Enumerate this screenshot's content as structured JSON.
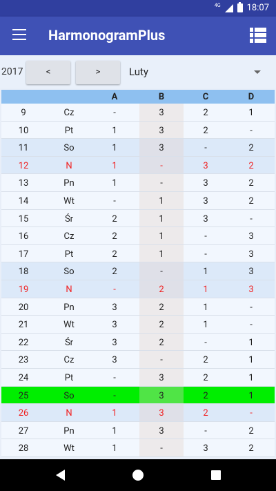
{
  "statusbar": {
    "network": "4G",
    "time": "18:07"
  },
  "appbar": {
    "title": "HarmonogramPlus"
  },
  "controls": {
    "year": "2017",
    "prev_label": "<",
    "next_label": ">",
    "month": "Luty"
  },
  "table": {
    "columns": [
      "A",
      "B",
      "C",
      "D"
    ],
    "rows": [
      {
        "day": "9",
        "dow": "Cz",
        "a": "-",
        "b": "3",
        "c": "2",
        "d": "1",
        "style": ""
      },
      {
        "day": "10",
        "dow": "Pt",
        "a": "1",
        "b": "3",
        "c": "2",
        "d": "-",
        "style": ""
      },
      {
        "day": "11",
        "dow": "So",
        "a": "1",
        "b": "3",
        "c": "-",
        "d": "2",
        "style": "weekend"
      },
      {
        "day": "12",
        "dow": "N",
        "a": "1",
        "b": "-",
        "c": "3",
        "d": "2",
        "style": "weekend holiday"
      },
      {
        "day": "13",
        "dow": "Pn",
        "a": "1",
        "b": "-",
        "c": "3",
        "d": "2",
        "style": ""
      },
      {
        "day": "14",
        "dow": "Wt",
        "a": "-",
        "b": "1",
        "c": "3",
        "d": "2",
        "style": ""
      },
      {
        "day": "15",
        "dow": "Śr",
        "a": "2",
        "b": "1",
        "c": "3",
        "d": "-",
        "style": ""
      },
      {
        "day": "16",
        "dow": "Cz",
        "a": "2",
        "b": "1",
        "c": "-",
        "d": "3",
        "style": ""
      },
      {
        "day": "17",
        "dow": "Pt",
        "a": "2",
        "b": "1",
        "c": "-",
        "d": "3",
        "style": ""
      },
      {
        "day": "18",
        "dow": "So",
        "a": "2",
        "b": "-",
        "c": "1",
        "d": "3",
        "style": "weekend"
      },
      {
        "day": "19",
        "dow": "N",
        "a": "-",
        "b": "2",
        "c": "1",
        "d": "3",
        "style": "weekend holiday"
      },
      {
        "day": "20",
        "dow": "Pn",
        "a": "3",
        "b": "2",
        "c": "1",
        "d": "-",
        "style": ""
      },
      {
        "day": "21",
        "dow": "Wt",
        "a": "3",
        "b": "2",
        "c": "1",
        "d": "-",
        "style": ""
      },
      {
        "day": "22",
        "dow": "Śr",
        "a": "3",
        "b": "2",
        "c": "-",
        "d": "1",
        "style": ""
      },
      {
        "day": "23",
        "dow": "Cz",
        "a": "3",
        "b": "-",
        "c": "2",
        "d": "1",
        "style": ""
      },
      {
        "day": "24",
        "dow": "Pt",
        "a": "-",
        "b": "3",
        "c": "2",
        "d": "1",
        "style": ""
      },
      {
        "day": "25",
        "dow": "So",
        "a": "-",
        "b": "3",
        "c": "2",
        "d": "1",
        "style": "today"
      },
      {
        "day": "26",
        "dow": "N",
        "a": "1",
        "b": "3",
        "c": "2",
        "d": "-",
        "style": "weekend holiday"
      },
      {
        "day": "27",
        "dow": "Pn",
        "a": "1",
        "b": "3",
        "c": "-",
        "d": "2",
        "style": ""
      },
      {
        "day": "28",
        "dow": "Wt",
        "a": "1",
        "b": "-",
        "c": "3",
        "d": "2",
        "style": ""
      }
    ]
  }
}
